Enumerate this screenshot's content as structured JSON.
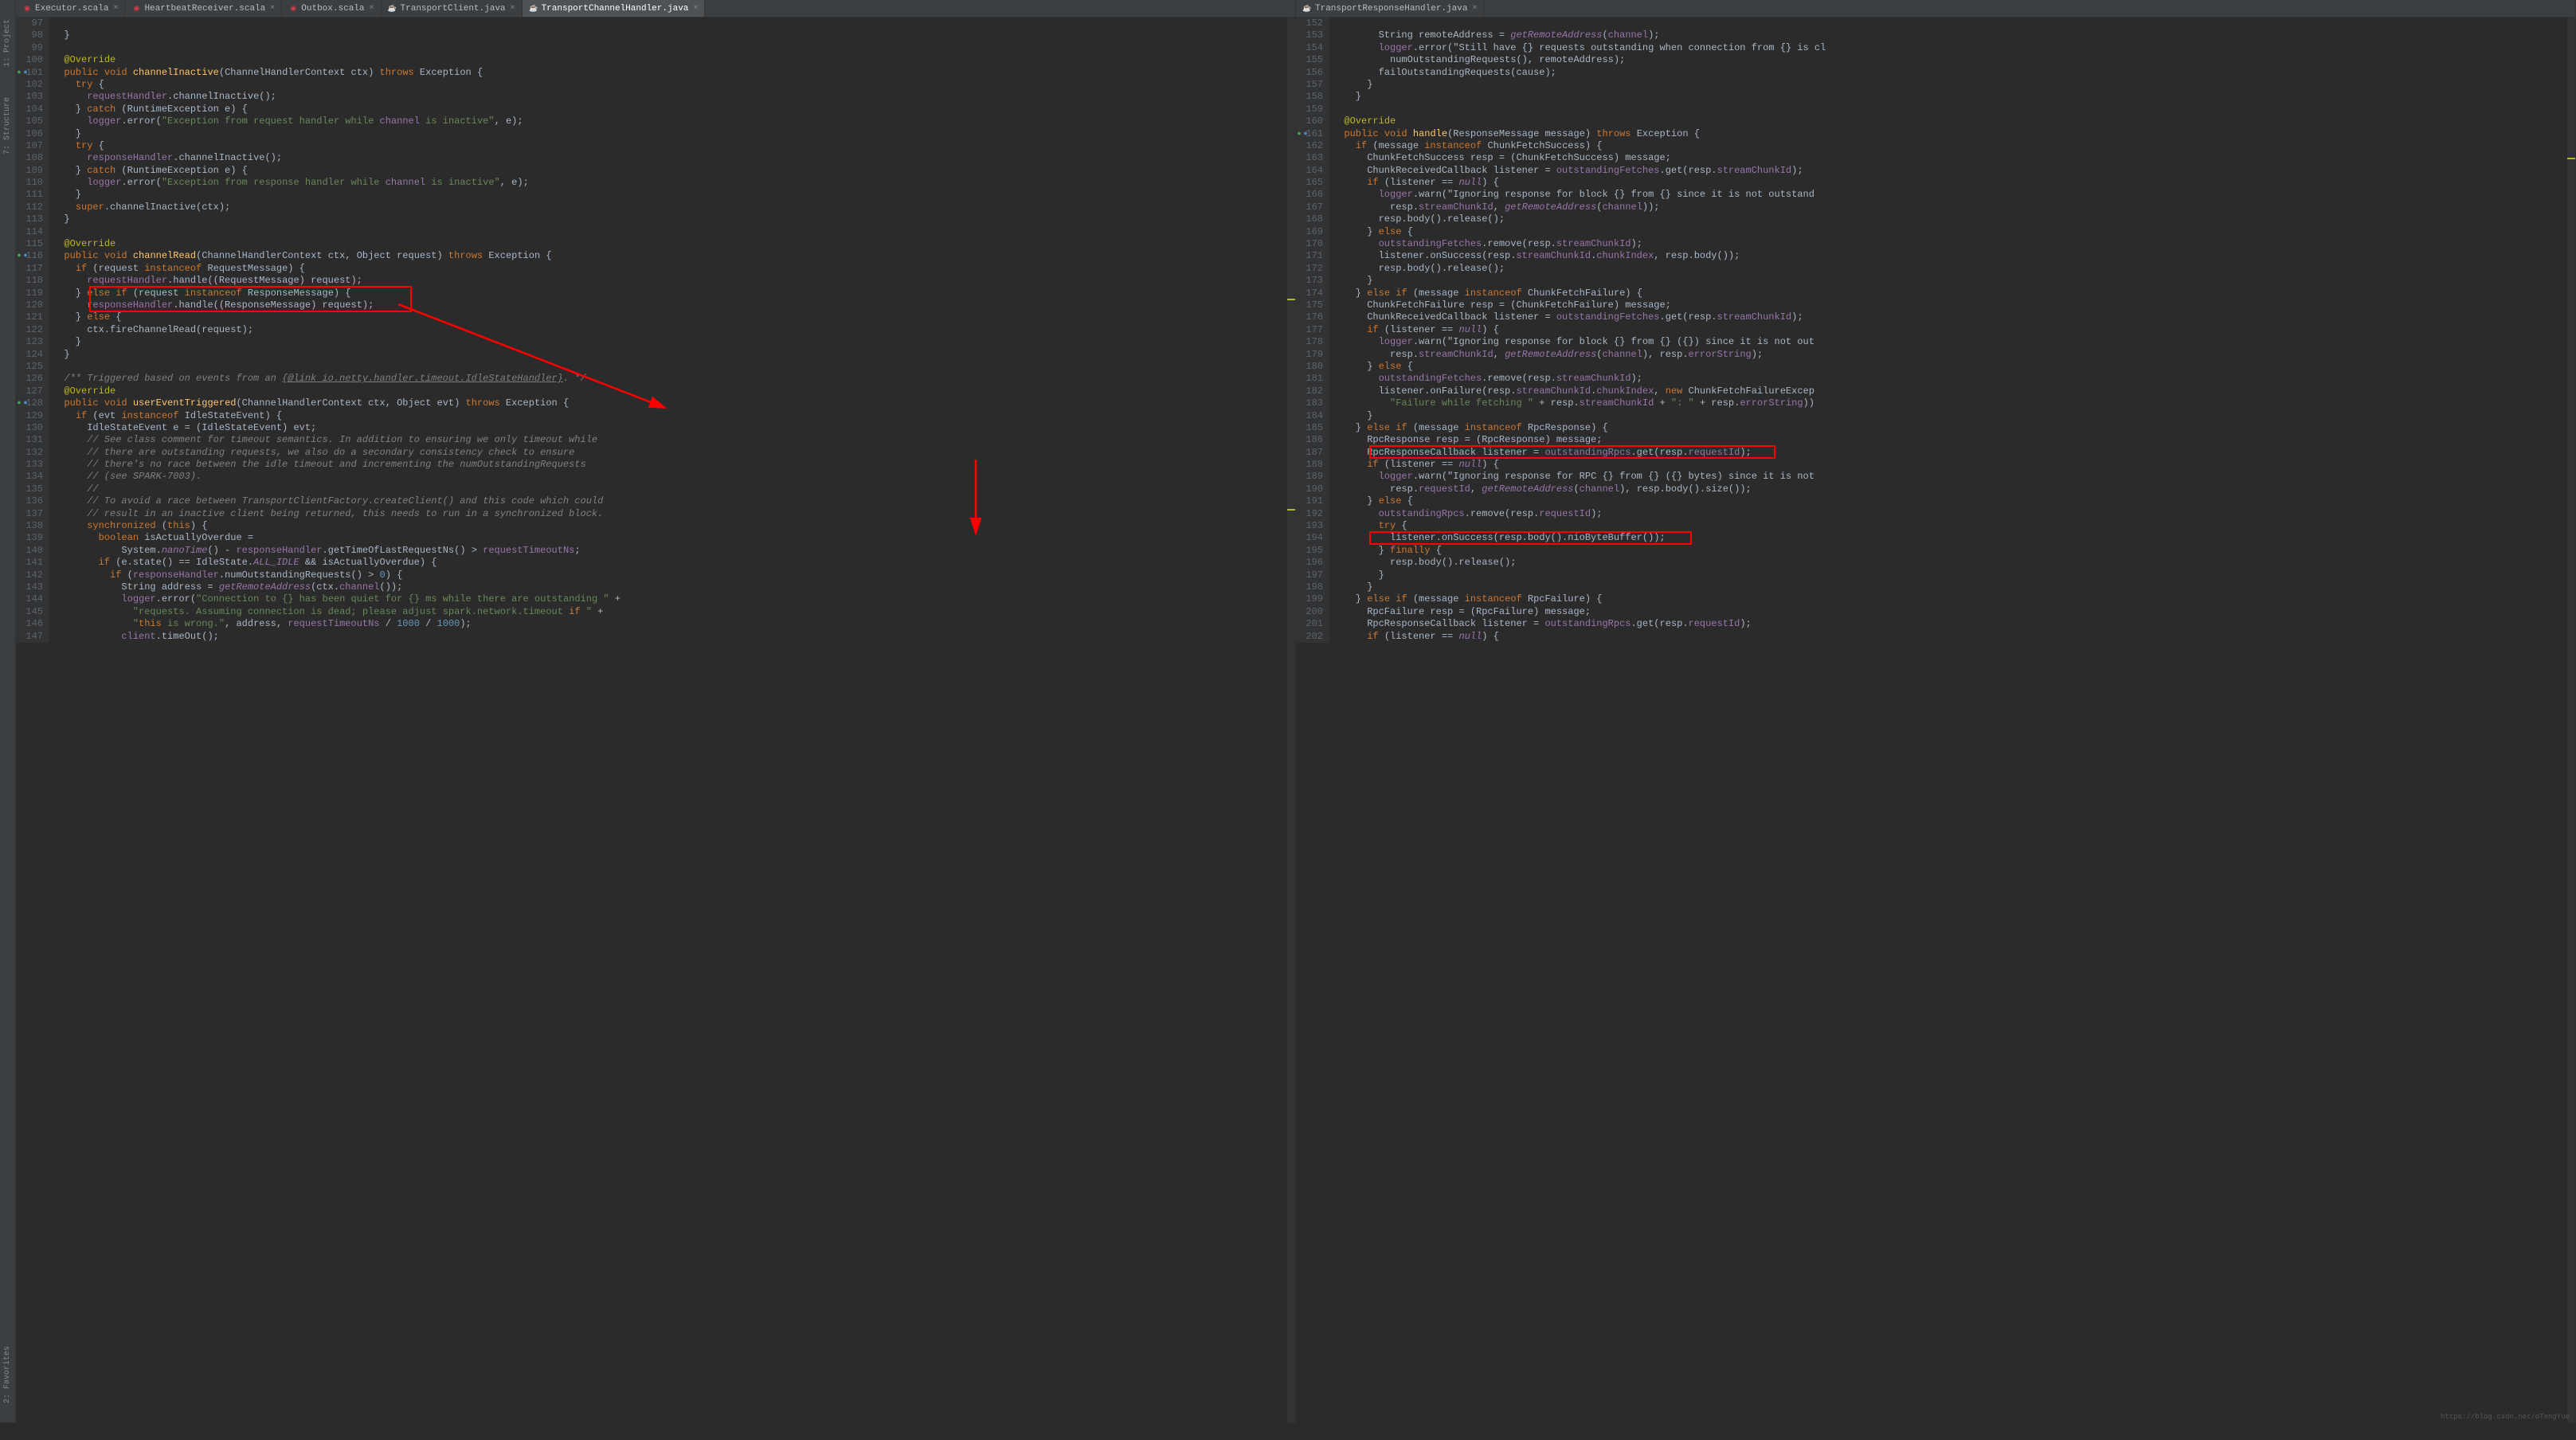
{
  "sidebar": {
    "items": [
      "1: Project",
      "7: Structure",
      "2: Favorites"
    ]
  },
  "tabs": [
    {
      "label": "Executor.scala",
      "type": "scala",
      "active": false
    },
    {
      "label": "HeartbeatReceiver.scala",
      "type": "scala",
      "active": false
    },
    {
      "label": "Outbox.scala",
      "type": "scala",
      "active": false
    },
    {
      "label": "TransportClient.java",
      "type": "java",
      "active": false
    },
    {
      "label": "TransportChannelHandler.java",
      "type": "java",
      "active": true
    },
    {
      "label": "TransportResponseHandler.java",
      "type": "java",
      "active": false,
      "rightPane": true
    }
  ],
  "left": {
    "startLine": 97,
    "lines": [
      {
        "n": 97,
        "t": "",
        "mk": ""
      },
      {
        "n": 98,
        "t": "  }",
        "mk": ""
      },
      {
        "n": 99,
        "t": "",
        "mk": ""
      },
      {
        "n": 100,
        "t": "  @Override",
        "mk": ""
      },
      {
        "n": 101,
        "t": "  public void channelInactive(ChannelHandlerContext ctx) throws Exception {",
        "mk": "gb"
      },
      {
        "n": 102,
        "t": "    try {",
        "mk": ""
      },
      {
        "n": 103,
        "t": "      requestHandler.channelInactive();",
        "mk": ""
      },
      {
        "n": 104,
        "t": "    } catch (RuntimeException e) {",
        "mk": ""
      },
      {
        "n": 105,
        "t": "      logger.error(\"Exception from request handler while channel is inactive\", e);",
        "mk": ""
      },
      {
        "n": 106,
        "t": "    }",
        "mk": ""
      },
      {
        "n": 107,
        "t": "    try {",
        "mk": ""
      },
      {
        "n": 108,
        "t": "      responseHandler.channelInactive();",
        "mk": ""
      },
      {
        "n": 109,
        "t": "    } catch (RuntimeException e) {",
        "mk": ""
      },
      {
        "n": 110,
        "t": "      logger.error(\"Exception from response handler while channel is inactive\", e);",
        "mk": ""
      },
      {
        "n": 111,
        "t": "    }",
        "mk": ""
      },
      {
        "n": 112,
        "t": "    super.channelInactive(ctx);",
        "mk": ""
      },
      {
        "n": 113,
        "t": "  }",
        "mk": ""
      },
      {
        "n": 114,
        "t": "",
        "mk": ""
      },
      {
        "n": 115,
        "t": "  @Override",
        "mk": ""
      },
      {
        "n": 116,
        "t": "  public void channelRead(ChannelHandlerContext ctx, Object request) throws Exception {",
        "mk": "gb"
      },
      {
        "n": 117,
        "t": "    if (request instanceof RequestMessage) {",
        "mk": ""
      },
      {
        "n": 118,
        "t": "      requestHandler.handle((RequestMessage) request);",
        "mk": ""
      },
      {
        "n": 119,
        "t": "    } else if (request instanceof ResponseMessage) {",
        "mk": "",
        "box": "a"
      },
      {
        "n": 120,
        "t": "      responseHandler.handle((ResponseMessage) request);",
        "mk": "",
        "box": "a"
      },
      {
        "n": 121,
        "t": "    } else {",
        "mk": ""
      },
      {
        "n": 122,
        "t": "      ctx.fireChannelRead(request);",
        "mk": ""
      },
      {
        "n": 123,
        "t": "    }",
        "mk": ""
      },
      {
        "n": 124,
        "t": "  }",
        "mk": ""
      },
      {
        "n": 125,
        "t": "",
        "mk": ""
      },
      {
        "n": 126,
        "t": "  /** Triggered based on events from an {@link io.netty.handler.timeout.IdleStateHandler}. */",
        "mk": ""
      },
      {
        "n": 127,
        "t": "  @Override",
        "mk": ""
      },
      {
        "n": 128,
        "t": "  public void userEventTriggered(ChannelHandlerContext ctx, Object evt) throws Exception {",
        "mk": "gb"
      },
      {
        "n": 129,
        "t": "    if (evt instanceof IdleStateEvent) {",
        "mk": ""
      },
      {
        "n": 130,
        "t": "      IdleStateEvent e = (IdleStateEvent) evt;",
        "mk": ""
      },
      {
        "n": 131,
        "t": "      // See class comment for timeout semantics. In addition to ensuring we only timeout while",
        "mk": ""
      },
      {
        "n": 132,
        "t": "      // there are outstanding requests, we also do a secondary consistency check to ensure",
        "mk": ""
      },
      {
        "n": 133,
        "t": "      // there's no race between the idle timeout and incrementing the numOutstandingRequests",
        "mk": ""
      },
      {
        "n": 134,
        "t": "      // (see SPARK-7003).",
        "mk": ""
      },
      {
        "n": 135,
        "t": "      //",
        "mk": ""
      },
      {
        "n": 136,
        "t": "      // To avoid a race between TransportClientFactory.createClient() and this code which could",
        "mk": ""
      },
      {
        "n": 137,
        "t": "      // result in an inactive client being returned, this needs to run in a synchronized block.",
        "mk": ""
      },
      {
        "n": 138,
        "t": "      synchronized (this) {",
        "mk": ""
      },
      {
        "n": 139,
        "t": "        boolean isActuallyOverdue =",
        "mk": ""
      },
      {
        "n": 140,
        "t": "            System.nanoTime() - responseHandler.getTimeOfLastRequestNs() > requestTimeoutNs;",
        "mk": ""
      },
      {
        "n": 141,
        "t": "        if (e.state() == IdleState.ALL_IDLE && isActuallyOverdue) {",
        "mk": ""
      },
      {
        "n": 142,
        "t": "          if (responseHandler.numOutstandingRequests() > 0) {",
        "mk": ""
      },
      {
        "n": 143,
        "t": "            String address = getRemoteAddress(ctx.channel());",
        "mk": ""
      },
      {
        "n": 144,
        "t": "            logger.error(\"Connection to {} has been quiet for {} ms while there are outstanding \" +",
        "mk": ""
      },
      {
        "n": 145,
        "t": "              \"requests. Assuming connection is dead; please adjust spark.network.timeout if \" +",
        "mk": ""
      },
      {
        "n": 146,
        "t": "              \"this is wrong.\", address, requestTimeoutNs / 1000 / 1000);",
        "mk": ""
      },
      {
        "n": 147,
        "t": "            client.timeOut();",
        "mk": ""
      }
    ]
  },
  "right": {
    "startLine": 152,
    "lines": [
      {
        "n": 152,
        "t": "",
        "mk": ""
      },
      {
        "n": 153,
        "t": "        String remoteAddress = getRemoteAddress(channel);",
        "mk": ""
      },
      {
        "n": 154,
        "t": "        logger.error(\"Still have {} requests outstanding when connection from {} is cl",
        "mk": ""
      },
      {
        "n": 155,
        "t": "          numOutstandingRequests(), remoteAddress);",
        "mk": ""
      },
      {
        "n": 156,
        "t": "        failOutstandingRequests(cause);",
        "mk": ""
      },
      {
        "n": 157,
        "t": "      }",
        "mk": ""
      },
      {
        "n": 158,
        "t": "    }",
        "mk": ""
      },
      {
        "n": 159,
        "t": "",
        "mk": ""
      },
      {
        "n": 160,
        "t": "  @Override",
        "mk": ""
      },
      {
        "n": 161,
        "t": "  public void handle(ResponseMessage message) throws Exception {",
        "mk": "gb"
      },
      {
        "n": 162,
        "t": "    if (message instanceof ChunkFetchSuccess) {",
        "mk": ""
      },
      {
        "n": 163,
        "t": "      ChunkFetchSuccess resp = (ChunkFetchSuccess) message;",
        "mk": ""
      },
      {
        "n": 164,
        "t": "      ChunkReceivedCallback listener = outstandingFetches.get(resp.streamChunkId);",
        "mk": ""
      },
      {
        "n": 165,
        "t": "      if (listener == null) {",
        "mk": ""
      },
      {
        "n": 166,
        "t": "        logger.warn(\"Ignoring response for block {} from {} since it is not outstand",
        "mk": ""
      },
      {
        "n": 167,
        "t": "          resp.streamChunkId, getRemoteAddress(channel));",
        "mk": ""
      },
      {
        "n": 168,
        "t": "        resp.body().release();",
        "mk": ""
      },
      {
        "n": 169,
        "t": "      } else {",
        "mk": ""
      },
      {
        "n": 170,
        "t": "        outstandingFetches.remove(resp.streamChunkId);",
        "mk": ""
      },
      {
        "n": 171,
        "t": "        listener.onSuccess(resp.streamChunkId.chunkIndex, resp.body());",
        "mk": ""
      },
      {
        "n": 172,
        "t": "        resp.body().release();",
        "mk": ""
      },
      {
        "n": 173,
        "t": "      }",
        "mk": ""
      },
      {
        "n": 174,
        "t": "    } else if (message instanceof ChunkFetchFailure) {",
        "mk": ""
      },
      {
        "n": 175,
        "t": "      ChunkFetchFailure resp = (ChunkFetchFailure) message;",
        "mk": ""
      },
      {
        "n": 176,
        "t": "      ChunkReceivedCallback listener = outstandingFetches.get(resp.streamChunkId);",
        "mk": ""
      },
      {
        "n": 177,
        "t": "      if (listener == null) {",
        "mk": ""
      },
      {
        "n": 178,
        "t": "        logger.warn(\"Ignoring response for block {} from {} ({}) since it is not out",
        "mk": ""
      },
      {
        "n": 179,
        "t": "          resp.streamChunkId, getRemoteAddress(channel), resp.errorString);",
        "mk": ""
      },
      {
        "n": 180,
        "t": "      } else {",
        "mk": ""
      },
      {
        "n": 181,
        "t": "        outstandingFetches.remove(resp.streamChunkId);",
        "mk": ""
      },
      {
        "n": 182,
        "t": "        listener.onFailure(resp.streamChunkId.chunkIndex, new ChunkFetchFailureExcep",
        "mk": ""
      },
      {
        "n": 183,
        "t": "          \"Failure while fetching \" + resp.streamChunkId + \": \" + resp.errorString))",
        "mk": ""
      },
      {
        "n": 184,
        "t": "      }",
        "mk": ""
      },
      {
        "n": 185,
        "t": "    } else if (message instanceof RpcResponse) {",
        "mk": ""
      },
      {
        "n": 186,
        "t": "      RpcResponse resp = (RpcResponse) message;",
        "mk": ""
      },
      {
        "n": 187,
        "t": "      RpcResponseCallback listener = outstandingRpcs.get(resp.requestId);",
        "mk": "",
        "box": "b"
      },
      {
        "n": 188,
        "t": "      if (listener == null) {",
        "mk": ""
      },
      {
        "n": 189,
        "t": "        logger.warn(\"Ignoring response for RPC {} from {} ({} bytes) since it is not",
        "mk": ""
      },
      {
        "n": 190,
        "t": "          resp.requestId, getRemoteAddress(channel), resp.body().size());",
        "mk": ""
      },
      {
        "n": 191,
        "t": "      } else {",
        "mk": ""
      },
      {
        "n": 192,
        "t": "        outstandingRpcs.remove(resp.requestId);",
        "mk": ""
      },
      {
        "n": 193,
        "t": "        try {",
        "mk": ""
      },
      {
        "n": 194,
        "t": "          listener.onSuccess(resp.body().nioByteBuffer());",
        "mk": "",
        "box": "c"
      },
      {
        "n": 195,
        "t": "        } finally {",
        "mk": ""
      },
      {
        "n": 196,
        "t": "          resp.body().release();",
        "mk": ""
      },
      {
        "n": 197,
        "t": "        }",
        "mk": ""
      },
      {
        "n": 198,
        "t": "      }",
        "mk": ""
      },
      {
        "n": 199,
        "t": "    } else if (message instanceof RpcFailure) {",
        "mk": ""
      },
      {
        "n": 200,
        "t": "      RpcFailure resp = (RpcFailure) message;",
        "mk": ""
      },
      {
        "n": 201,
        "t": "      RpcResponseCallback listener = outstandingRpcs.get(resp.requestId);",
        "mk": ""
      },
      {
        "n": 202,
        "t": "      if (listener == null) {",
        "mk": ""
      }
    ]
  },
  "footer": "https://blog.csdn.net/oTengYue"
}
